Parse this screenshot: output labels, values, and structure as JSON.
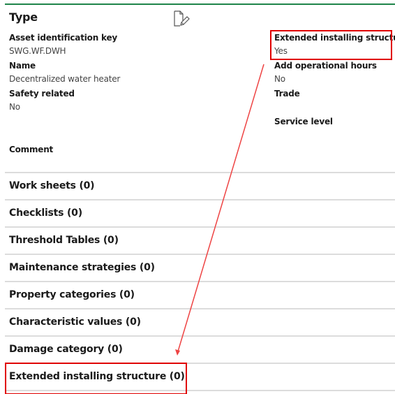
{
  "header": {
    "title": "Type",
    "edit_icon": "edit-document-icon"
  },
  "left_fields": [
    {
      "label": "Asset identification key",
      "value": "SWG.WF.DWH"
    },
    {
      "label": "Name",
      "value": "Decentralized water heater"
    },
    {
      "label": "Safety related",
      "value": "No"
    },
    {
      "label": "Comment",
      "value": ""
    }
  ],
  "right_fields": [
    {
      "label": "Extended installing structure",
      "value": "Yes"
    },
    {
      "label": "Add operational hours",
      "value": "No"
    },
    {
      "label": "Trade",
      "value": ""
    },
    {
      "label": "Service level",
      "value": ""
    }
  ],
  "sections": [
    {
      "label": "Work sheets (0)"
    },
    {
      "label": "Checklists (0)"
    },
    {
      "label": "Threshold Tables (0)"
    },
    {
      "label": "Maintenance strategies (0)"
    },
    {
      "label": "Property categories (0)"
    },
    {
      "label": "Characteristic values (0)"
    },
    {
      "label": "Damage category (0)"
    },
    {
      "label": "Extended installing structure (0)"
    }
  ],
  "colors": {
    "accent": "#1e8449",
    "highlight": "#e00000",
    "annotation_arrow": "#ee4444",
    "separator": "#dcdcdc"
  }
}
